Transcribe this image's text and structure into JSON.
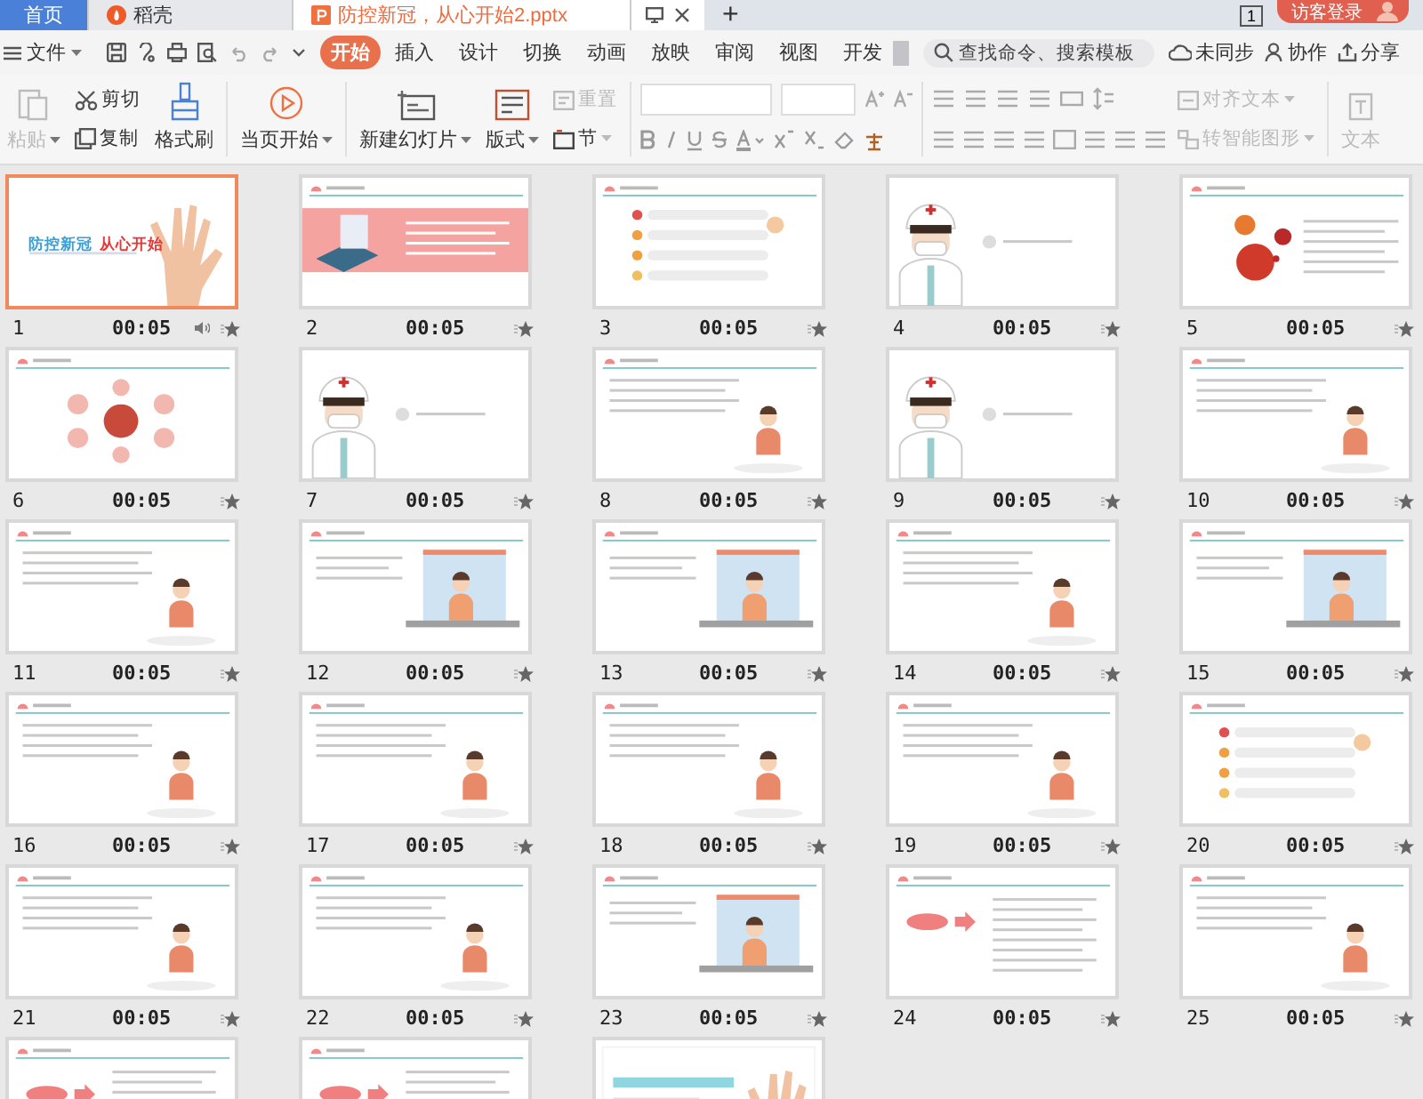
{
  "tabs": [
    {
      "label": "首页",
      "selected": false,
      "kind": "home"
    },
    {
      "label": "稻壳",
      "selected": false,
      "kind": "store"
    },
    {
      "label": "防控新冠，从心开始2.pptx",
      "selected": true,
      "kind": "doc"
    }
  ],
  "new_tab": "+",
  "page_indicator": "1",
  "login_button": "访客登录",
  "file_menu": "文件",
  "ribbon_tabs": [
    {
      "label": "开始",
      "selected": true
    },
    {
      "label": "插入",
      "selected": false
    },
    {
      "label": "设计",
      "selected": false
    },
    {
      "label": "切换",
      "selected": false
    },
    {
      "label": "动画",
      "selected": false
    },
    {
      "label": "放映",
      "selected": false
    },
    {
      "label": "审阅",
      "selected": false
    },
    {
      "label": "视图",
      "selected": false
    },
    {
      "label": "开发",
      "selected": false
    }
  ],
  "search": {
    "placeholder": "查找命令、搜索模板"
  },
  "actions": [
    "未同步",
    "协作",
    "分享"
  ],
  "ribbon": [
    {
      "kind": "big",
      "label": "粘贴",
      "disabled": true,
      "dropdown": true
    },
    {
      "kind": "pair",
      "items": [
        {
          "label": "剪切",
          "disabled": false
        },
        {
          "label": "复制",
          "disabled": false
        }
      ]
    },
    {
      "kind": "big",
      "label": "格式刷",
      "disabled": false,
      "dropdown": false
    },
    {
      "kind": "divider"
    },
    {
      "kind": "big",
      "label": "当页开始",
      "disabled": false,
      "dropdown": true
    },
    {
      "kind": "divider"
    },
    {
      "kind": "big",
      "label": "新建幻灯片",
      "disabled": false,
      "dropdown": true
    },
    {
      "kind": "big",
      "label": "版式",
      "disabled": false,
      "dropdown": true
    },
    {
      "kind": "pair",
      "items": [
        {
          "label": "重置",
          "disabled": true
        },
        {
          "label": "节",
          "disabled": false,
          "dropdown": true
        }
      ]
    },
    {
      "kind": "divider"
    },
    {
      "kind": "font"
    },
    {
      "kind": "divider"
    },
    {
      "kind": "paragraph"
    },
    {
      "kind": "pair",
      "items": [
        {
          "label": "对齐文本",
          "disabled": true,
          "dropdown": true
        },
        {
          "label": "转智能图形",
          "disabled": true,
          "dropdown": true
        }
      ]
    },
    {
      "kind": "divider"
    },
    {
      "kind": "big",
      "label": "文本",
      "disabled": true,
      "dropdown": false
    }
  ],
  "slides": [
    {
      "number": "1",
      "time": "00:05",
      "sound": true,
      "selected": true,
      "kind": "title",
      "title": [
        "防控新冠",
        "从心开始"
      ]
    },
    {
      "number": "2",
      "time": "00:05",
      "sound": false,
      "selected": false,
      "kind": "banner"
    },
    {
      "number": "3",
      "time": "00:05",
      "sound": false,
      "selected": false,
      "kind": "list"
    },
    {
      "number": "4",
      "time": "00:05",
      "sound": false,
      "selected": false,
      "kind": "doctor"
    },
    {
      "number": "5",
      "time": "00:05",
      "sound": false,
      "selected": false,
      "kind": "virus"
    },
    {
      "number": "6",
      "time": "00:05",
      "sound": false,
      "selected": false,
      "kind": "circles"
    },
    {
      "number": "7",
      "time": "00:05",
      "sound": false,
      "selected": false,
      "kind": "doctor"
    },
    {
      "number": "8",
      "time": "00:05",
      "sound": false,
      "selected": false,
      "kind": "figure"
    },
    {
      "number": "9",
      "time": "00:05",
      "sound": false,
      "selected": false,
      "kind": "doctor"
    },
    {
      "number": "10",
      "time": "00:05",
      "sound": false,
      "selected": false,
      "kind": "figure"
    },
    {
      "number": "11",
      "time": "00:05",
      "sound": false,
      "selected": false,
      "kind": "figure"
    },
    {
      "number": "12",
      "time": "00:05",
      "sound": false,
      "selected": false,
      "kind": "room"
    },
    {
      "number": "13",
      "time": "00:05",
      "sound": false,
      "selected": false,
      "kind": "room"
    },
    {
      "number": "14",
      "time": "00:05",
      "sound": false,
      "selected": false,
      "kind": "figure"
    },
    {
      "number": "15",
      "time": "00:05",
      "sound": false,
      "selected": false,
      "kind": "room"
    },
    {
      "number": "16",
      "time": "00:05",
      "sound": false,
      "selected": false,
      "kind": "figure"
    },
    {
      "number": "17",
      "time": "00:05",
      "sound": false,
      "selected": false,
      "kind": "figure"
    },
    {
      "number": "18",
      "time": "00:05",
      "sound": false,
      "selected": false,
      "kind": "figure"
    },
    {
      "number": "19",
      "time": "00:05",
      "sound": false,
      "selected": false,
      "kind": "figure"
    },
    {
      "number": "20",
      "time": "00:05",
      "sound": false,
      "selected": false,
      "kind": "list"
    },
    {
      "number": "21",
      "time": "00:05",
      "sound": false,
      "selected": false,
      "kind": "figure"
    },
    {
      "number": "22",
      "time": "00:05",
      "sound": false,
      "selected": false,
      "kind": "figure"
    },
    {
      "number": "23",
      "time": "00:05",
      "sound": false,
      "selected": false,
      "kind": "room"
    },
    {
      "number": "24",
      "time": "00:05",
      "sound": false,
      "selected": false,
      "kind": "arrows"
    },
    {
      "number": "25",
      "time": "00:05",
      "sound": false,
      "selected": false,
      "kind": "figure"
    },
    {
      "selected": false,
      "kind": "arrows"
    },
    {
      "selected": false,
      "kind": "arrows"
    },
    {
      "selected": false,
      "kind": "closing"
    }
  ]
}
